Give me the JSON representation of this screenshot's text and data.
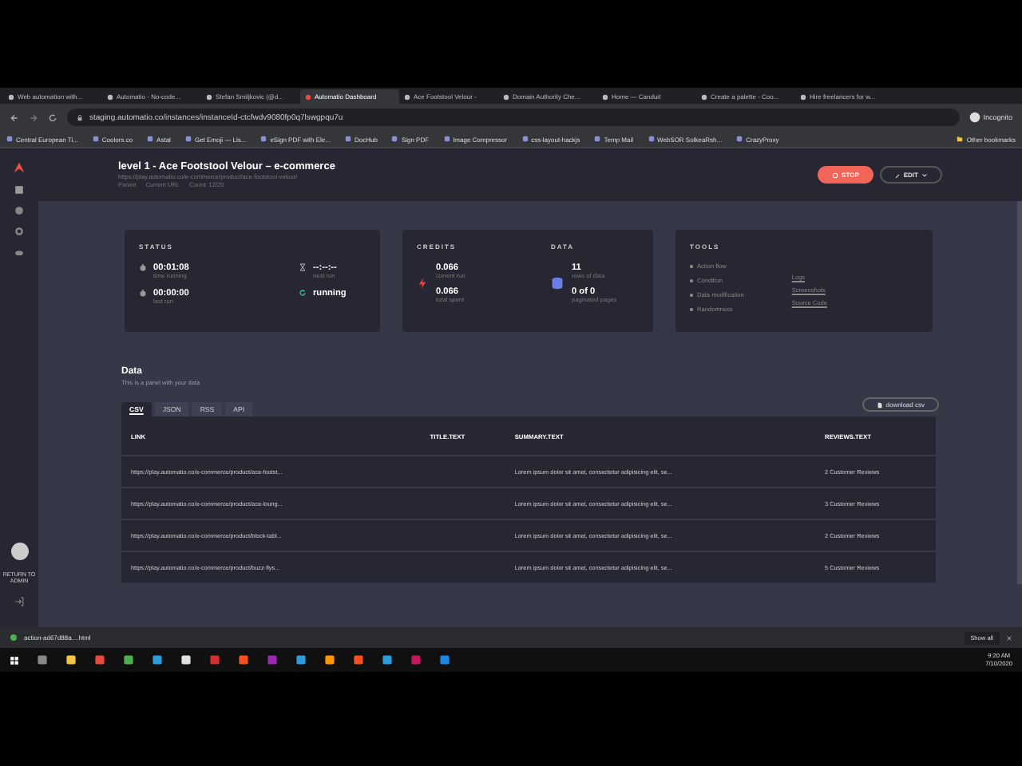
{
  "browser": {
    "tabs": [
      {
        "title": "Web automation with...",
        "selected": false
      },
      {
        "title": "Automatio - No-code...",
        "selected": false
      },
      {
        "title": "Stefan Smiljkovic (@d...",
        "selected": false
      },
      {
        "title": "Automatio Dashboard",
        "selected": true
      },
      {
        "title": "Ace Footstool Velour -",
        "selected": false
      },
      {
        "title": "Domain Authority Che...",
        "selected": false
      },
      {
        "title": "Home — Canduit",
        "selected": false
      },
      {
        "title": "Create a palette - Coo...",
        "selected": false
      },
      {
        "title": "Hire freelancers for w...",
        "selected": false
      }
    ],
    "address": "staging.automatio.co/instances/instanceId-ctcfwdv9080fp0q7lswgpqu7u",
    "profile": "Incognito",
    "bookmarks": [
      "Central European Ti...",
      "Coolors.co",
      "Astal",
      "Get Emoji — Lis...",
      "eSign PDF with Ele...",
      "DocHub",
      "Sign PDF",
      "Image Compressor",
      "css-layout-hackjs",
      "Temp Mail",
      "WebSOR SolkeaRsh...",
      "CrazyProxy"
    ],
    "other_bookmarks": "Other bookmarks"
  },
  "app": {
    "sidebar": {
      "return_label": "RETURN TO ADMIN"
    },
    "header": {
      "title": "level 1 - Ace Footstool Velour – e-commerce",
      "url": "https://play.automatio.co/e-commerce/product/ace-footstool-velour/",
      "meta": [
        "Parent",
        "Current URL",
        "Count: 12/20"
      ],
      "stop": "STOP",
      "edit": "EDIT"
    },
    "status": {
      "title": "STATUS",
      "items": [
        {
          "kind": "timer",
          "value": "00:01:08",
          "label": "time running"
        },
        {
          "kind": "hourglass",
          "value": "--:--:--",
          "label": "next run"
        },
        {
          "kind": "timer",
          "value": "00:00:00",
          "label": "last run"
        },
        {
          "kind": "refresh",
          "value": "running"
        }
      ]
    },
    "credits": {
      "title": "CREDITS",
      "items": [
        {
          "value": "0.066",
          "label": "current run"
        },
        {
          "value": "0.066",
          "label": "total spent"
        }
      ]
    },
    "data_card": {
      "title": "DATA",
      "items": [
        {
          "value": "11",
          "label": "rows of data"
        },
        {
          "value": "0 of 0",
          "label": "paginated pages"
        }
      ]
    },
    "tools": {
      "title": "TOOLS",
      "left": [
        "Action flow",
        "Condition",
        "Data modification",
        "Randomness"
      ],
      "right": [
        "Logs",
        "Screenshots",
        "Source Code"
      ]
    },
    "data_panel": {
      "title": "Data",
      "subtitle": "This is a panel with your data",
      "tabs": [
        {
          "label": "CSV",
          "selected": true
        },
        {
          "label": "JSON",
          "selected": false
        },
        {
          "label": "RSS",
          "selected": false
        },
        {
          "label": "API",
          "selected": false
        }
      ],
      "download": "download csv",
      "table": {
        "columns": [
          "LINK",
          "TITLE.TEXT",
          "SUMMARY.TEXT",
          "REVIEWS.TEXT"
        ],
        "rows": [
          [
            "https://play.automatio.co/e-commerce/product/ace-footst...",
            "",
            "Lorem ipsum dolor sit amet, consectetur adipisicing elit, se...",
            "2 Customer Reviews"
          ],
          [
            "https://play.automatio.co/e-commerce/product/ace-loung...",
            "",
            "Lorem ipsum dolor sit amet, consectetur adipisicing elit, se...",
            "3 Customer Reviews"
          ],
          [
            "https://play.automatio.co/e-commerce/product/block-tabl...",
            "",
            "Lorem ipsum dolor sit amet, consectetur adipisicing elit, se...",
            "2 Customer Reviews"
          ],
          [
            "https://play.automatio.co/e-commerce/product/buzz-flys...",
            "",
            "Lorem ipsum dolor sit amet, consectetur adipisicing elit, se...",
            "5 Customer Reviews"
          ]
        ]
      }
    }
  },
  "downloads": {
    "file": "action-ad67d88a....html",
    "show_all": "Show all"
  },
  "taskbar": {
    "time": "9:20 AM",
    "date": "7/10/2020"
  }
}
